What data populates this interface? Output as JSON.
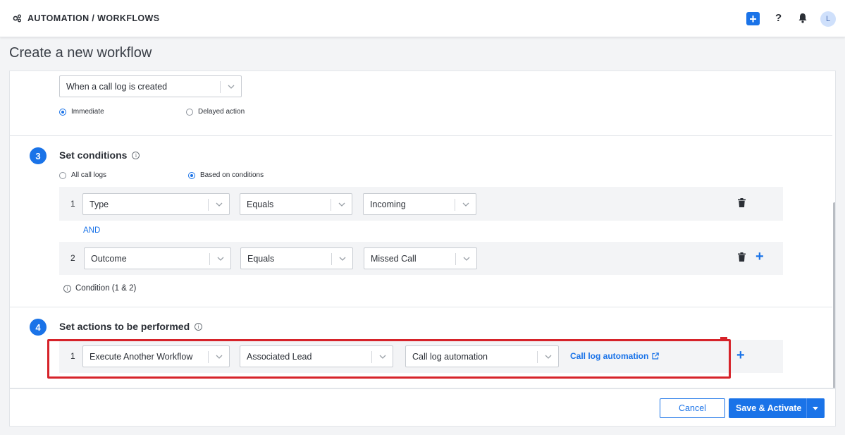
{
  "topbar": {
    "breadcrumb": "AUTOMATION / WORKFLOWS",
    "breadcrumb_icon": "gears-icon",
    "actions": [
      "add-icon",
      "help-icon",
      "bell-icon"
    ],
    "avatar_initial": "L"
  },
  "page": {
    "title": "Create a new workflow"
  },
  "trigger": {
    "event_select": "When a call log is created",
    "timing_options": [
      {
        "label": "Immediate",
        "selected": true
      },
      {
        "label": "Delayed action",
        "selected": false
      }
    ]
  },
  "conditions": {
    "step_number": "3",
    "title": "Set conditions",
    "mode_options": [
      {
        "label": "All call logs",
        "selected": false
      },
      {
        "label": "Based on conditions",
        "selected": true
      }
    ],
    "rows": [
      {
        "num": "1",
        "field": "Type",
        "operator": "Equals",
        "value": "Incoming"
      },
      {
        "num": "2",
        "field": "Outcome",
        "operator": "Equals",
        "value": "Missed Call"
      }
    ],
    "joiner": "AND",
    "summary": "Condition (1 & 2)"
  },
  "actions": {
    "step_number": "4",
    "title": "Set actions to be performed",
    "rows": [
      {
        "num": "1",
        "action": "Execute Another Workflow",
        "target": "Associated Lead",
        "workflow": "Call log automation",
        "link_label": "Call log automation"
      }
    ]
  },
  "footer": {
    "cancel_label": "Cancel",
    "save_label": "Save & Activate"
  },
  "colors": {
    "accent": "#1a73e8",
    "highlight": "#d6232a"
  }
}
